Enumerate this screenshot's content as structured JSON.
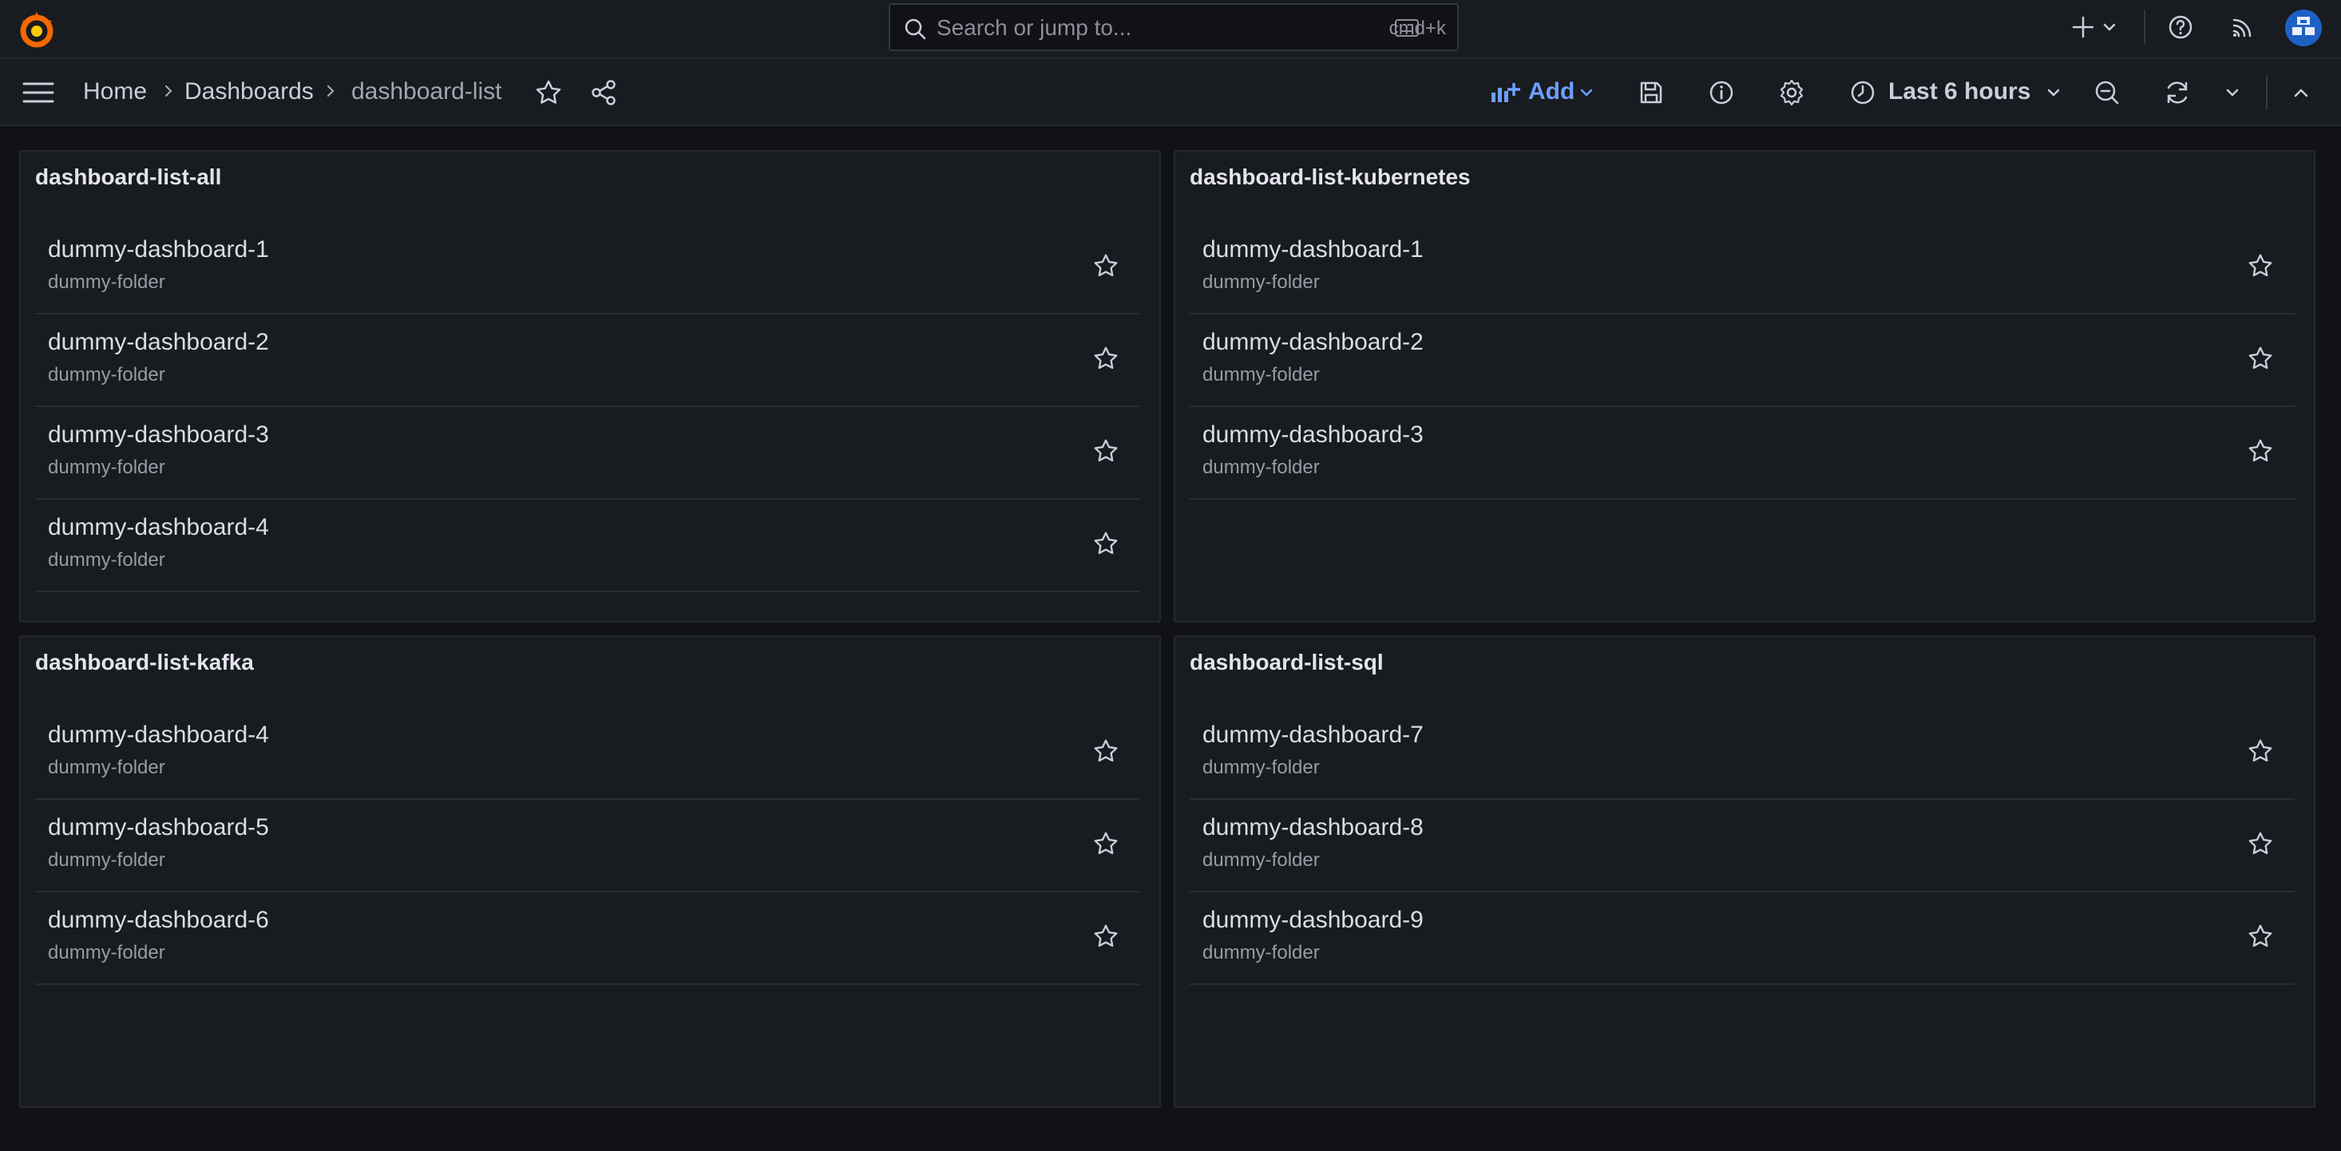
{
  "search": {
    "placeholder": "Search or jump to...",
    "shortcut": "cmd+k"
  },
  "breadcrumb": {
    "home": "Home",
    "dashboards": "Dashboards",
    "current": "dashboard-list"
  },
  "toolbar": {
    "add_label": "Add",
    "time_range": "Last 6 hours"
  },
  "colors": {
    "accent": "#6e9fff",
    "logo": "#f46800"
  },
  "icons": [
    "grafana-logo-icon",
    "search-icon",
    "keyboard-icon",
    "plus-icon",
    "chevron-down-icon",
    "help-icon",
    "rss-icon",
    "avatar",
    "menu-icon",
    "star-icon",
    "share-icon",
    "add-panel-icon",
    "save-icon",
    "info-icon",
    "gear-icon",
    "clock-icon",
    "zoom-out-icon",
    "refresh-icon",
    "chevron-up-icon"
  ],
  "panels": [
    {
      "title": "dashboard-list-all",
      "items": [
        {
          "name": "dummy-dashboard-1",
          "folder": "dummy-folder"
        },
        {
          "name": "dummy-dashboard-2",
          "folder": "dummy-folder"
        },
        {
          "name": "dummy-dashboard-3",
          "folder": "dummy-folder"
        },
        {
          "name": "dummy-dashboard-4",
          "folder": "dummy-folder"
        }
      ]
    },
    {
      "title": "dashboard-list-kubernetes",
      "items": [
        {
          "name": "dummy-dashboard-1",
          "folder": "dummy-folder"
        },
        {
          "name": "dummy-dashboard-2",
          "folder": "dummy-folder"
        },
        {
          "name": "dummy-dashboard-3",
          "folder": "dummy-folder"
        }
      ]
    },
    {
      "title": "dashboard-list-kafka",
      "items": [
        {
          "name": "dummy-dashboard-4",
          "folder": "dummy-folder"
        },
        {
          "name": "dummy-dashboard-5",
          "folder": "dummy-folder"
        },
        {
          "name": "dummy-dashboard-6",
          "folder": "dummy-folder"
        }
      ]
    },
    {
      "title": "dashboard-list-sql",
      "items": [
        {
          "name": "dummy-dashboard-7",
          "folder": "dummy-folder"
        },
        {
          "name": "dummy-dashboard-8",
          "folder": "dummy-folder"
        },
        {
          "name": "dummy-dashboard-9",
          "folder": "dummy-folder"
        }
      ]
    }
  ]
}
